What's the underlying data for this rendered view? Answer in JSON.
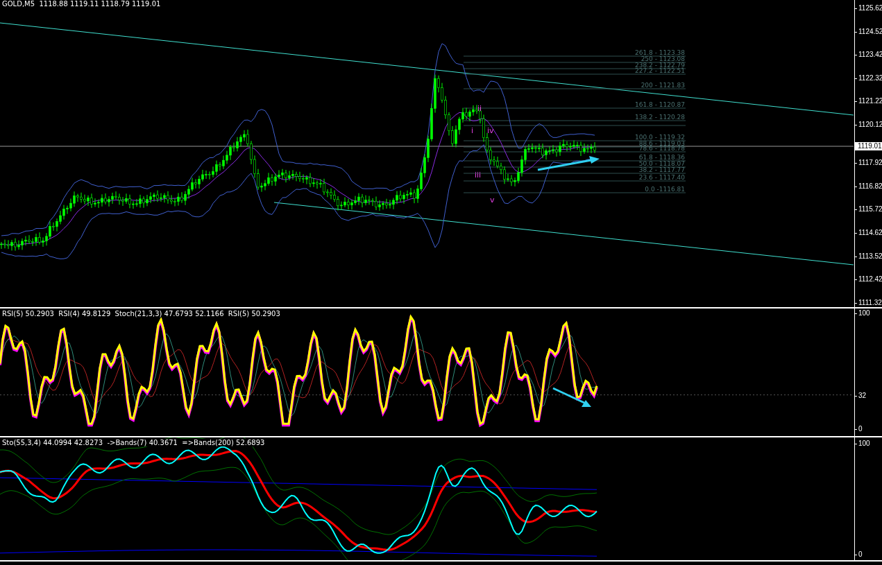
{
  "main_pane": {
    "header": "GOLD,M5  1118.88 1119.11 1118.79 1119.01",
    "price_axis": [
      "1125.62",
      "1124.52",
      "1123.42",
      "1122.32",
      "1121.22",
      "1120.12",
      "1119.01",
      "1117.92",
      "1116.82",
      "1115.72",
      "1114.62",
      "1113.52",
      "1112.42",
      "1111.32"
    ],
    "fib_levels": [
      "261.8 - 1123.38",
      "250 - 1123.08",
      "238.2 - 1122.79",
      "227.2 - 1122.51",
      "200 - 1121.83",
      "161.8 - 1120.87",
      "138.2 - 1120.28",
      "100.0 - 1119.32",
      "88.6 - 1119.03",
      "78.6 - 1118.78",
      "61.8 - 1118.36",
      "50.0 - 1118.07",
      "38.2 - 1117.77",
      "23.6 - 1117.40",
      "0.0 -1116.81"
    ],
    "wave_labels": [
      "ii",
      "i",
      "iv",
      "iii",
      "v"
    ]
  },
  "rsi_pane": {
    "header": "RSI(5) 50.2903  RSI(4) 49.8129  Stoch(21,3,3) 47.6793 52.1166  RSI(5) 50.2903",
    "axis": [
      "100",
      "32",
      "0"
    ]
  },
  "sto_pane": {
    "header": "Sto(55,3,4) 44.0994 42.8273  ->Bands(7) 40.3671  =>Bands(200) 52.6893",
    "axis": [
      "100",
      "0"
    ]
  }
}
